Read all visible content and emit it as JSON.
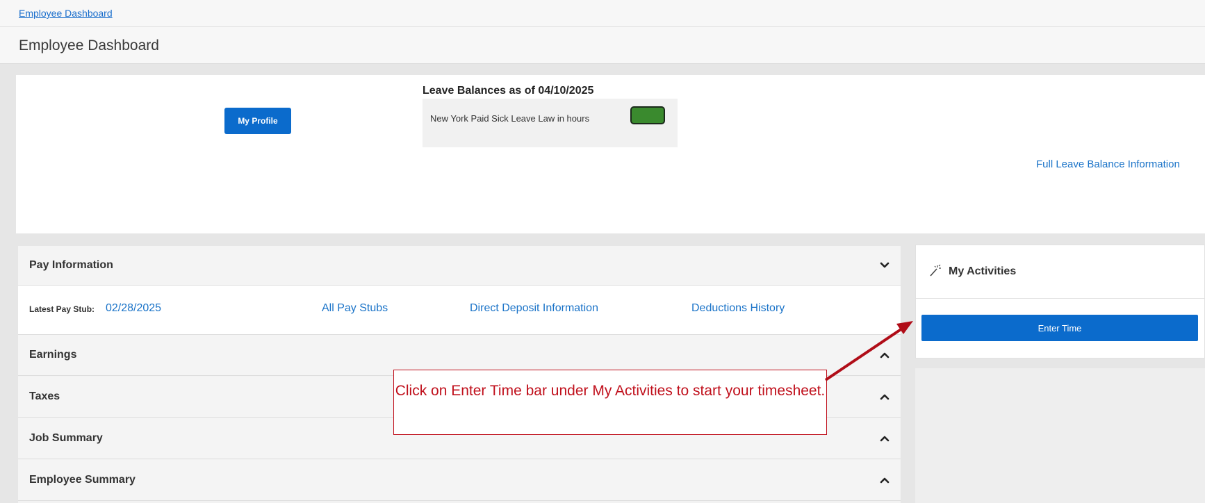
{
  "breadcrumb": {
    "label": "Employee Dashboard"
  },
  "page": {
    "title": "Employee Dashboard"
  },
  "profile": {
    "button_label": "My Profile"
  },
  "leave": {
    "title": "Leave Balances as of 04/10/2025",
    "items": [
      {
        "label": "New York Paid Sick Leave Law in hours",
        "swatch_color": "#3a8a2e"
      }
    ],
    "full_link": "Full Leave Balance Information"
  },
  "pay": {
    "header": "Pay Information",
    "latest_stub_label": "Latest Pay Stub:",
    "latest_stub_date": "02/28/2025",
    "links": {
      "all_stubs": "All Pay Stubs",
      "direct_deposit": "Direct Deposit Information",
      "deductions": "Deductions History"
    },
    "sections": [
      {
        "label": "Earnings"
      },
      {
        "label": "Taxes"
      },
      {
        "label": "Job Summary"
      },
      {
        "label": "Employee Summary"
      }
    ]
  },
  "activities": {
    "title": "My Activities",
    "enter_time": "Enter Time"
  },
  "callout": {
    "text": "Click on Enter Time bar under My Activities to start your timesheet."
  },
  "colors": {
    "brand_blue": "#0b6bcc",
    "link_blue": "#1a73c8",
    "callout_red": "#c0101c"
  }
}
